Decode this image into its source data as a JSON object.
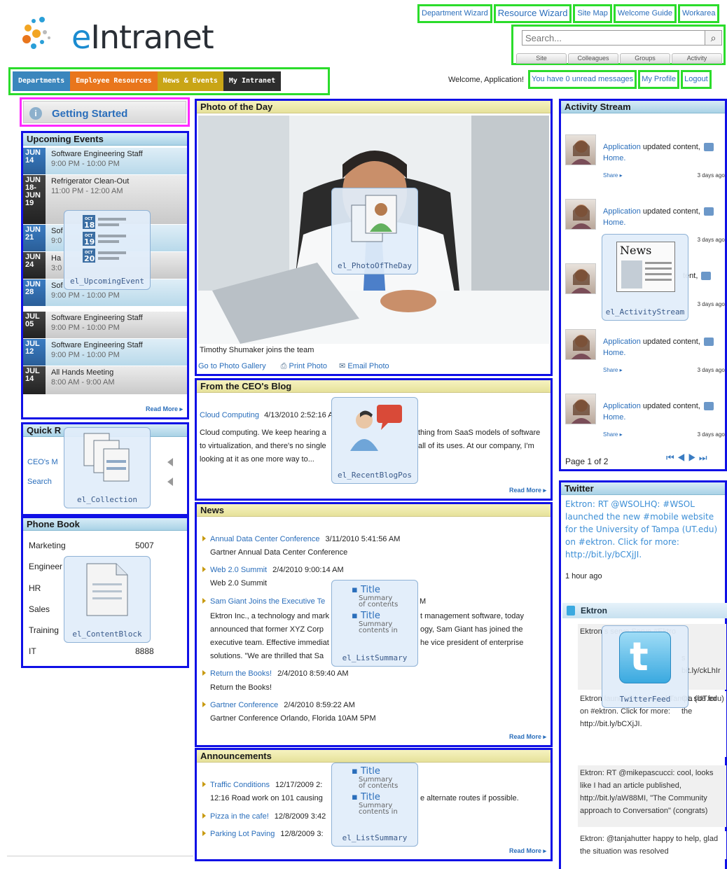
{
  "brand": {
    "name_e": "e",
    "name_rest": "Intranet"
  },
  "utility_links": [
    "Department Wizard",
    "Resource Wizard",
    "Site Map",
    "Welcome Guide",
    "Workarea"
  ],
  "search": {
    "placeholder": "Search...",
    "tabs": [
      "Site",
      "Colleagues",
      "Groups",
      "Activity"
    ]
  },
  "main_nav": [
    {
      "label": "Departments",
      "color": "#3a86bd"
    },
    {
      "label": "Employee Resources",
      "color": "#e9761c"
    },
    {
      "label": "News & Events",
      "color": "#c9a516"
    },
    {
      "label": "My Intranet",
      "color": "#2d2d2d"
    }
  ],
  "welcome": {
    "text": "Welcome, Application!",
    "messages": "You have 0 unread messages",
    "profile": "My Profile",
    "logout": "Logout"
  },
  "getting_started": {
    "icon": "info-icon",
    "label": "Getting Started"
  },
  "upcoming_events": {
    "title": "Upcoming Events",
    "read_more": "Read More",
    "items": [
      {
        "month": "JUN",
        "day": "14",
        "title": "Software Engineering Staff",
        "time": "9:00 PM - 10:00 PM"
      },
      {
        "month": "JUN",
        "day": "18-",
        "month2": "JUN",
        "day2": "19",
        "title": "Refrigerator Clean-Out",
        "time": "11:00 PM - 12:00 AM"
      },
      {
        "month": "JUN",
        "day": "21",
        "title": "Sof",
        "time": "9:0"
      },
      {
        "month": "JUN",
        "day": "24",
        "title": "Ha",
        "time": "3:0"
      },
      {
        "month": "JUN",
        "day": "28",
        "title": "Sof",
        "time": "9:00 PM - 10:00 PM"
      },
      {
        "month": "JUL",
        "day": "05",
        "title": "Software Engineering Staff",
        "time": "9:00 PM - 10:00 PM"
      },
      {
        "month": "JUL",
        "day": "12",
        "title": "Software Engineering Staff",
        "time": "9:00 PM - 10:00 PM"
      },
      {
        "month": "JUL",
        "day": "14",
        "title": "All Hands Meeting",
        "time": "8:00 AM - 9:00 AM"
      }
    ],
    "overlay": "el_UpcomingEvent",
    "cal_badges": [
      {
        "m": "OCT",
        "d": "18"
      },
      {
        "m": "OCT",
        "d": "19"
      },
      {
        "m": "OCT",
        "d": "20"
      }
    ]
  },
  "quick_links": {
    "title": "Quick R",
    "items": [
      "CEO's M",
      "Search"
    ],
    "overlay": "el_Collection"
  },
  "phone_book": {
    "title": "Phone Book",
    "rows": [
      {
        "dept": "Marketing",
        "ext": "5007"
      },
      {
        "dept": "Engineer",
        "ext": ""
      },
      {
        "dept": "HR",
        "ext": ""
      },
      {
        "dept": "Sales",
        "ext": ""
      },
      {
        "dept": "Training",
        "ext": ""
      },
      {
        "dept": "IT",
        "ext": "8888"
      }
    ],
    "overlay": "el_ContentBlock"
  },
  "photo_of_day": {
    "title": "Photo of the Day",
    "caption": "Timothy Shumaker joins the team",
    "links": [
      "Go to Photo Gallery",
      "Print Photo",
      "Email Photo"
    ],
    "overlay": "el_PhotoOfTheDay"
  },
  "ceo_blog": {
    "title": "From the CEO's Blog",
    "post_link": "Cloud Computing",
    "post_date": "4/13/2010 2:52:16 A",
    "line1a": "Cloud computing. We keep hearing a",
    "line1b": "thing from SaaS models of software",
    "line2a": "to virtualization, and there's no single",
    "line2b": "all of its uses. At our company, I'm",
    "line3": "looking at it as one more way to...",
    "read_more": "Read More",
    "overlay": "el_RecentBlogPos"
  },
  "news": {
    "title": "News",
    "read_more": "Read More",
    "items": [
      {
        "title": "Annual Data Center Conference",
        "date": "3/11/2010 5:41:56 AM",
        "desc": "Gartner Annual Data Center Conference"
      },
      {
        "title": "Web 2.0 Summit",
        "date": "2/4/2010 9:00:14 AM",
        "desc": "Web 2.0 Summit"
      },
      {
        "title": "Sam Giant Joins the Executive Te",
        "date": "M"
      },
      {
        "title": "Return the Books!",
        "date": "2/4/2010 8:59:40 AM",
        "desc": "Return the Books!"
      },
      {
        "title": "Gartner Conference",
        "date": "2/4/2010 8:59:22 AM",
        "desc": "Gartner Conference Orlando, Florida 10AM 5PM"
      }
    ],
    "sam_lines": [
      {
        "a": "Ektron Inc., a technology and mark",
        "b": "t management software, today"
      },
      {
        "a": "announced that former XYZ Corp",
        "b": "ogy, Sam Giant has joined the"
      },
      {
        "a": "executive team. Effective immediat",
        "b": "he vice president of enterprise"
      },
      {
        "a": "solutions. \"We are thrilled that Sa",
        "b": ""
      }
    ],
    "overlay": "el_ListSummary"
  },
  "announcements": {
    "title": "Announcements",
    "read_more": "Read More",
    "items": [
      {
        "title": "Traffic Conditions",
        "date": "12/17/2009 2:"
      },
      {
        "title": "Pizza in the cafe!",
        "date": "12/8/2009 3:42"
      },
      {
        "title": "Parking Lot Paving",
        "date": "12/8/2009 3:"
      }
    ],
    "traffic_desc_a": "12:16  Road work on 101 causing",
    "traffic_desc_b": "e alternate routes if possible.",
    "overlay": "el_ListSummary"
  },
  "list_summary": {
    "t1": "Title",
    "s1a": "Summary",
    "s1b": "of contents",
    "t2": "Title",
    "s2a": "Summary",
    "s2b": "contents in"
  },
  "activity_stream": {
    "title": "Activity Stream",
    "items": [
      {
        "user": "Application",
        "action": "updated content,",
        "target": "Home.",
        "share": "Share",
        "ago": "3 days ago."
      },
      {
        "user": "Application",
        "action": "updated content,",
        "target": "Home.",
        "share": "",
        "ago": "3 days ago."
      },
      {
        "user": "",
        "action": "tent,",
        "target": "",
        "share": "",
        "ago": "3 days ago."
      },
      {
        "user": "Application",
        "action": "updated content,",
        "target": "Home.",
        "share": "Share",
        "ago": "3 days ago."
      },
      {
        "user": "Application",
        "action": "updated content,",
        "target": "Home.",
        "share": "Share",
        "ago": "3 days ago."
      }
    ],
    "pager": "Page 1 of 2",
    "overlay": "el_ActivityStream",
    "overlay_news": "News"
  },
  "twitter": {
    "title": "Twitter",
    "main_tweet": "Ektron: RT @WSOLHQ: #WSOL launched the new #mobile website for the University of Tampa (UT.edu) on #ektron. Click for more: http://bit.ly/bCXjJI.",
    "ago": "1 hour ago",
    "feed_title": "Ektron",
    "feed": [
      {
        "text": "Ektron s serve Serve #Ektro",
        "text_r": "s bit.ly/ckLhIr"
      },
      {
        "text": "Ektron launc University of Tampa (UT.edu) on #ektron. Click for more: http://bit.ly/bCXjJI.",
        "text_r": "OL site for the"
      },
      {
        "text": "Ektron: RT @mikepascucci: cool, looks like I had an article published, http://bit.ly/aW88MI, \"The Community approach to Conversation\" (congrats)"
      },
      {
        "text": "Ektron: @tanjahutter happy to help, glad the situation was resolved"
      }
    ],
    "overlay": "TwitterFeed"
  }
}
